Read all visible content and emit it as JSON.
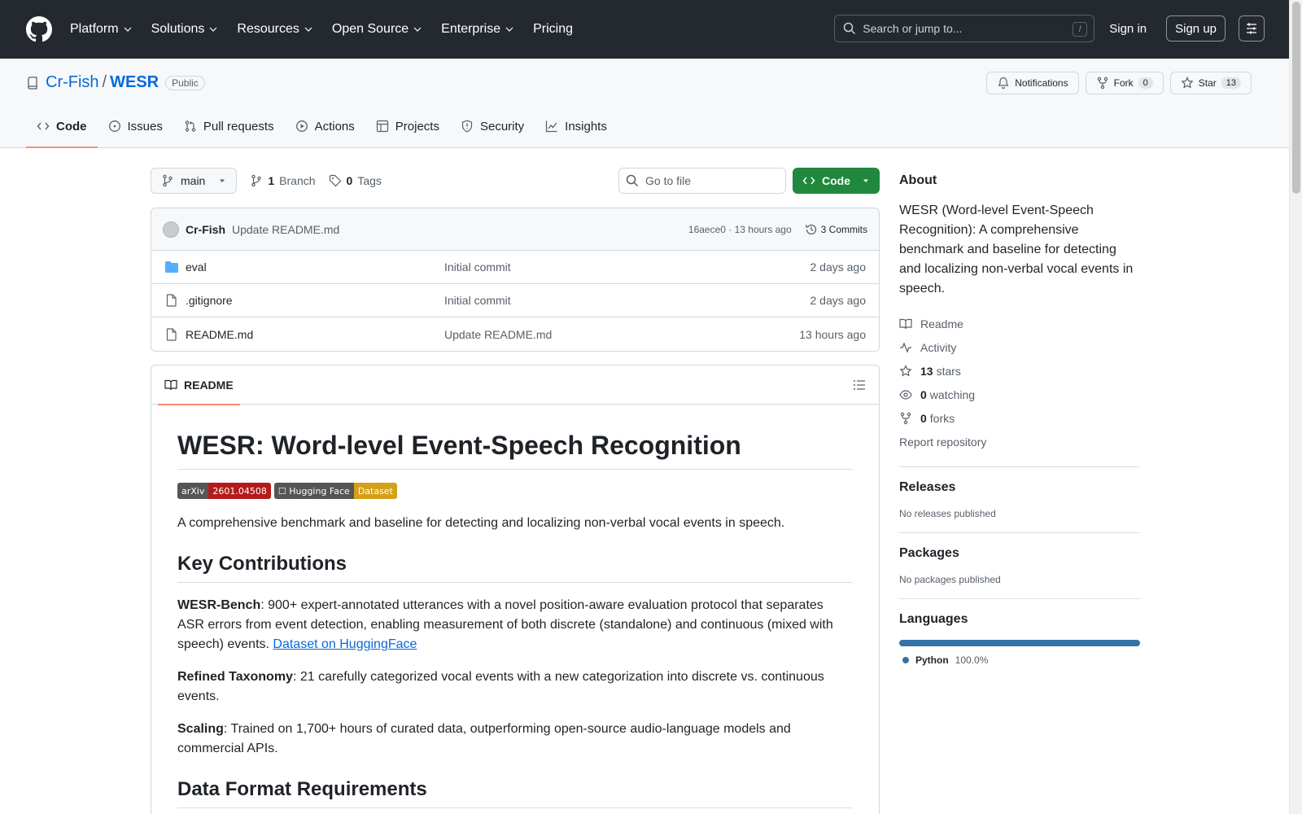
{
  "header": {
    "nav": [
      "Platform",
      "Solutions",
      "Resources",
      "Open Source",
      "Enterprise"
    ],
    "pricing": "Pricing",
    "search_placeholder": "Search or jump to...",
    "search_shortcut": "/",
    "sign_in": "Sign in",
    "sign_up": "Sign up"
  },
  "repo": {
    "owner": "Cr-Fish",
    "separator": "/",
    "name": "WESR",
    "visibility": "Public",
    "notifications": "Notifications",
    "fork_label": "Fork",
    "fork_count": "0",
    "star_label": "Star",
    "star_count": "13",
    "tabs": [
      "Code",
      "Issues",
      "Pull requests",
      "Actions",
      "Projects",
      "Security",
      "Insights"
    ]
  },
  "filenav": {
    "branch": "main",
    "branch_count": "1",
    "branch_label": "Branch",
    "tag_count": "0",
    "tag_label": "Tags",
    "goto_placeholder": "Go to file",
    "code_button": "Code"
  },
  "commit": {
    "author": "Cr-Fish",
    "message": "Update README.md",
    "meta": "16aece0 · 13 hours ago",
    "count": "3 Commits"
  },
  "files": [
    {
      "name": "eval",
      "type": "folder",
      "message": "Initial commit",
      "date": "2 days ago"
    },
    {
      "name": ".gitignore",
      "type": "file",
      "message": "Initial commit",
      "date": "2 days ago"
    },
    {
      "name": "README.md",
      "type": "file",
      "message": "Update README.md",
      "date": "13 hours ago"
    }
  ],
  "readme": {
    "tab": "README",
    "title": "WESR: Word-level Event-Speech Recognition",
    "badges": [
      {
        "left": "arXiv",
        "right": "2601.04508",
        "color": "#b31b1b"
      },
      {
        "left": "☐ Hugging Face",
        "right": "Dataset",
        "color": "#d4a017"
      }
    ],
    "intro": "A comprehensive benchmark and baseline for detecting and localizing non-verbal vocal events in speech.",
    "h2_contrib": "Key Contributions",
    "c1_bold": "WESR-Bench",
    "c1_text": ": 900+ expert-annotated utterances with a novel position-aware evaluation protocol that separates ASR errors from event detection, enabling measurement of both discrete (standalone) and continuous (mixed with speech) events. ",
    "c1_link": "Dataset on HuggingFace",
    "c2_bold": "Refined Taxonomy",
    "c2_text": ": 21 carefully categorized vocal events with a new categorization into discrete vs. continuous events.",
    "c3_bold": "Scaling",
    "c3_text": ": Trained on 1,700+ hours of curated data, outperforming open-source audio-language models and commercial APIs.",
    "h2_format": "Data Format Requirements"
  },
  "about": {
    "heading": "About",
    "description": "WESR (Word-level Event-Speech Recognition): A comprehensive benchmark and baseline for detecting and localizing non-verbal vocal events in speech.",
    "readme": "Readme",
    "activity": "Activity",
    "stars_count": "13",
    "stars_label": "stars",
    "watching_count": "0",
    "watching_label": "watching",
    "forks_count": "0",
    "forks_label": "forks",
    "report": "Report repository"
  },
  "releases": {
    "heading": "Releases",
    "text": "No releases published"
  },
  "packages": {
    "heading": "Packages",
    "text": "No packages published"
  },
  "languages": {
    "heading": "Languages",
    "name": "Python",
    "percent": "100.0%",
    "color": "#3572a5"
  }
}
